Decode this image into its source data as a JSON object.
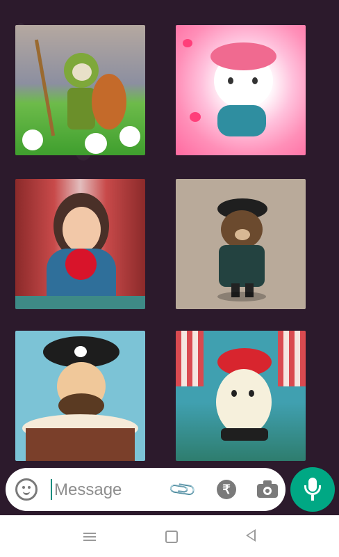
{
  "chat": {
    "stickers": [
      {
        "description": ""
      },
      {
        "description": ""
      },
      {
        "description": ""
      },
      {
        "description": ""
      },
      {
        "description": ""
      },
      {
        "description": ""
      }
    ]
  },
  "composer": {
    "placeholder": "Message",
    "icons": [
      "emoji-icon",
      "attach-icon",
      "rupee-icon",
      "camera-icon"
    ]
  },
  "colors": {
    "accent": "#00a884",
    "chat_background": "#2c1a2c"
  }
}
